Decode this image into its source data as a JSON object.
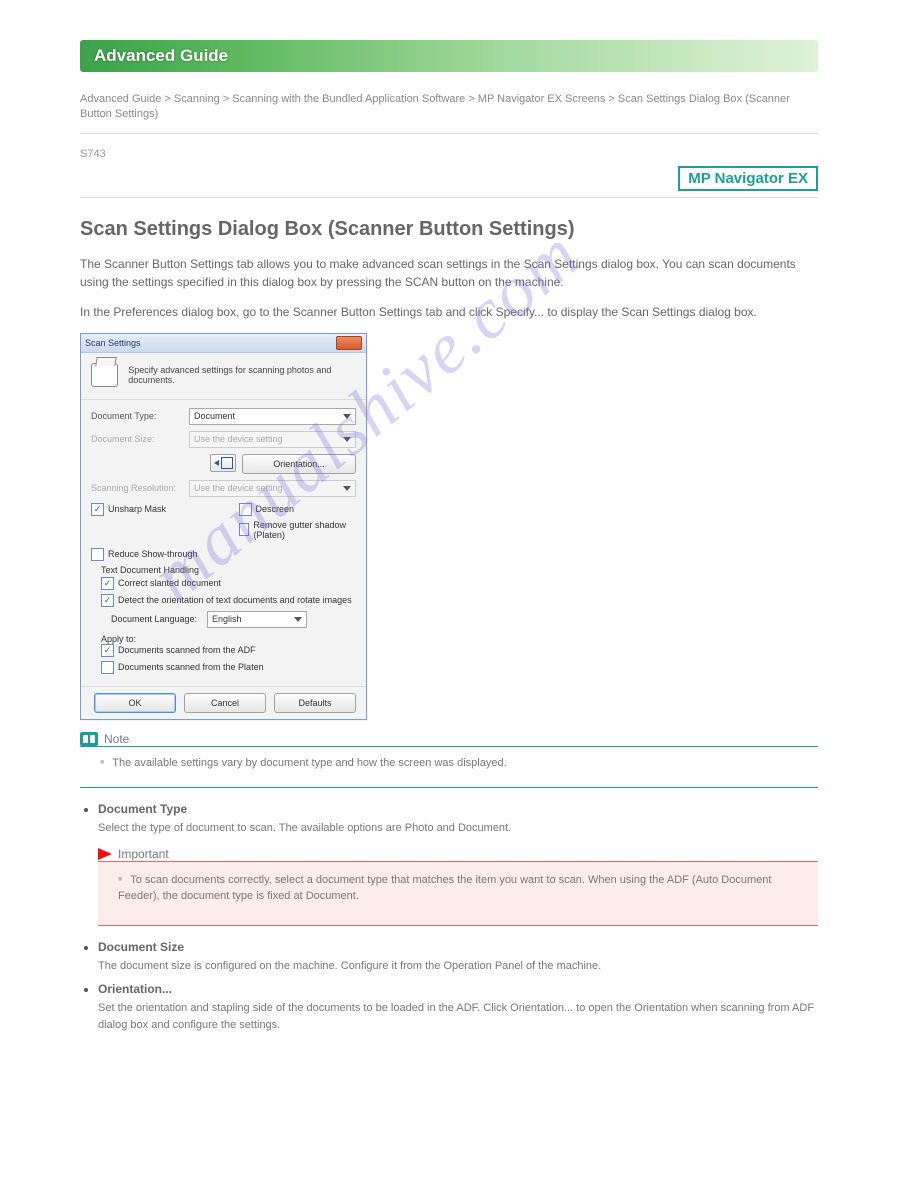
{
  "header": {
    "guide_label": "Advanced Guide",
    "breadcrumb": "Advanced Guide > Scanning > Scanning with the Bundled Application Software > MP Navigator EX Screens > Scan Settings Dialog Box (Scanner Button Settings)",
    "doc_code": "S743",
    "nav_badge": "MP Navigator EX"
  },
  "page": {
    "title": "Scan Settings Dialog Box (Scanner Button Settings)",
    "intro1": "The Scanner Button Settings tab allows you to make advanced scan settings in the Scan Settings dialog box. You can scan documents using the settings specified in this dialog box by pressing the SCAN button on the machine.",
    "intro2": "In the Preferences dialog box, go to the Scanner Button Settings tab and click Specify... to display the Scan Settings dialog box."
  },
  "dialog": {
    "title": "Scan Settings",
    "header_desc": "Specify advanced settings for scanning photos and documents.",
    "fields": {
      "doc_type_label": "Document Type:",
      "doc_type_value": "Document",
      "doc_size_label": "Document Size:",
      "doc_size_value": "Use the device setting",
      "orientation_btn": "Orientation...",
      "scan_res_label": "Scanning Resolution:",
      "scan_res_value": "Use the device setting",
      "descreen": "Descreen",
      "unsharp": "Unsharp Mask",
      "remove_gutter": "Remove gutter shadow (Platen)",
      "reduce_show": "Reduce Show-through",
      "text_handling": "Text Document Handling",
      "correct_slanted": "Correct slanted document",
      "detect_orient": "Detect the orientation of text documents and rotate images",
      "doc_lang_label": "Document Language:",
      "doc_lang_value": "English",
      "apply_to": "Apply to:",
      "from_adf": "Documents scanned from the ADF",
      "from_platen": "Documents scanned from the Platen"
    },
    "buttons": {
      "ok": "OK",
      "cancel": "Cancel",
      "defaults": "Defaults"
    }
  },
  "note": {
    "label": "Note",
    "items": [
      "The available settings vary by document type and how the screen was displayed."
    ]
  },
  "items": [
    {
      "title": "Document Type",
      "body": "Select the type of document to scan. The available options are Photo and Document.",
      "important": {
        "label": "Important",
        "lines": [
          "To scan documents correctly, select a document type that matches the item you want to scan. When using the ADF (Auto Document Feeder), the document type is fixed at Document."
        ]
      }
    },
    {
      "title": "Document Size",
      "body": "The document size is configured on the machine. Configure it from the Operation Panel of the machine."
    },
    {
      "title": "Orientation...",
      "body": "Set the orientation and stapling side of the documents to be loaded in the ADF. Click Orientation... to open the Orientation when scanning from ADF dialog box and configure the settings."
    }
  ],
  "watermark": "manualshive.com"
}
